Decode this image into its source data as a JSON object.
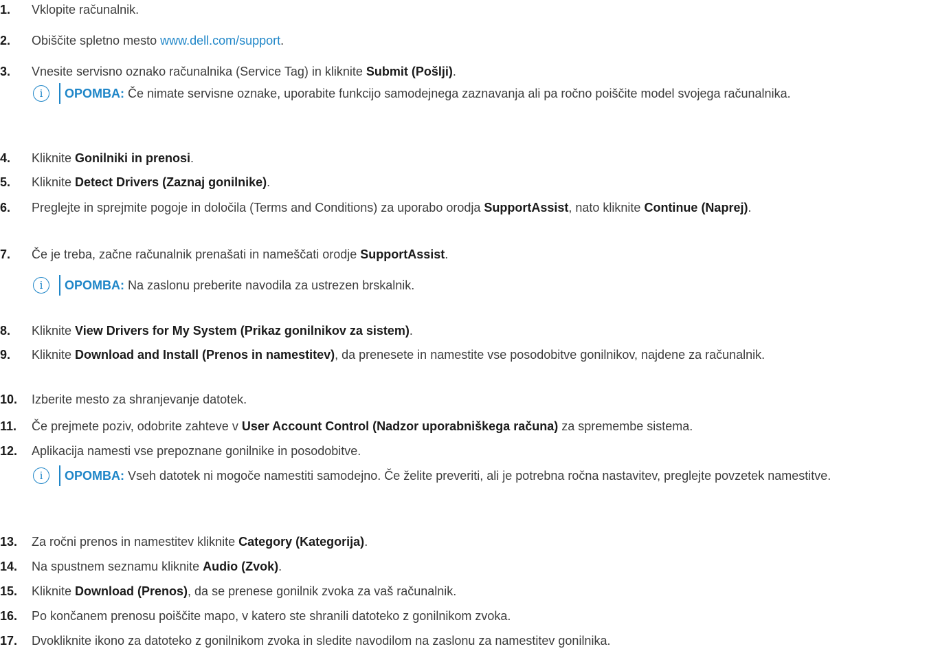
{
  "steps": [
    {
      "num": "1.",
      "parts": [
        {
          "t": "Vklopite računalnik."
        }
      ]
    },
    {
      "num": "2.",
      "parts": [
        {
          "t": "Obiščite spletno mesto "
        },
        {
          "t": "www.dell.com/support",
          "link": true
        },
        {
          "t": "."
        }
      ]
    },
    {
      "num": "3.",
      "parts": [
        {
          "t": "Vnesite servisno oznako računalnika (Service Tag) in kliknite "
        },
        {
          "t": "Submit (Pošlji)",
          "b": true
        },
        {
          "t": "."
        }
      ]
    },
    {
      "num": "4.",
      "parts": [
        {
          "t": "Kliknite "
        },
        {
          "t": "Gonilniki in prenosi",
          "b": true
        },
        {
          "t": "."
        }
      ]
    },
    {
      "num": "5.",
      "parts": [
        {
          "t": "Kliknite "
        },
        {
          "t": "Detect Drivers (Zaznaj gonilnike)",
          "b": true
        },
        {
          "t": "."
        }
      ]
    },
    {
      "num": "6.",
      "parts": [
        {
          "t": "Preglejte in sprejmite pogoje in določila (Terms and Conditions) za uporabo orodja "
        },
        {
          "t": "SupportAssist",
          "b": true
        },
        {
          "t": ", nato kliknite "
        },
        {
          "t": "Continue (Naprej)",
          "b": true
        },
        {
          "t": "."
        }
      ]
    },
    {
      "num": "7.",
      "parts": [
        {
          "t": "Če je treba, začne računalnik prenašati in nameščati orodje "
        },
        {
          "t": "SupportAssist",
          "b": true
        },
        {
          "t": "."
        }
      ]
    },
    {
      "num": "8.",
      "parts": [
        {
          "t": "Kliknite "
        },
        {
          "t": "View Drivers for My System (Prikaz gonilnikov za sistem)",
          "b": true
        },
        {
          "t": "."
        }
      ]
    },
    {
      "num": "9.",
      "parts": [
        {
          "t": "Kliknite "
        },
        {
          "t": "Download and Install (Prenos in namestitev)",
          "b": true
        },
        {
          "t": ", da prenesete in namestite vse posodobitve gonilnikov, najdene za računalnik."
        }
      ]
    },
    {
      "num": "10.",
      "parts": [
        {
          "t": "Izberite mesto za shranjevanje datotek."
        }
      ]
    },
    {
      "num": "11.",
      "parts": [
        {
          "t": "Če prejmete poziv, odobrite zahteve v "
        },
        {
          "t": "User Account Control (Nadzor uporabniškega računa)",
          "b": true
        },
        {
          "t": " za spremembe sistema."
        }
      ]
    },
    {
      "num": "12.",
      "parts": [
        {
          "t": "Aplikacija namesti vse prepoznane gonilnike in posodobitve."
        }
      ]
    },
    {
      "num": "13.",
      "parts": [
        {
          "t": "Za ročni prenos in namestitev kliknite "
        },
        {
          "t": "Category (Kategorija)",
          "b": true
        },
        {
          "t": "."
        }
      ]
    },
    {
      "num": "14.",
      "parts": [
        {
          "t": "Na spustnem seznamu kliknite "
        },
        {
          "t": "Audio (Zvok)",
          "b": true
        },
        {
          "t": "."
        }
      ]
    },
    {
      "num": "15.",
      "parts": [
        {
          "t": "Kliknite "
        },
        {
          "t": "Download (Prenos)",
          "b": true
        },
        {
          "t": ", da se prenese gonilnik zvoka za vaš računalnik."
        }
      ]
    },
    {
      "num": "16.",
      "parts": [
        {
          "t": "Po končanem prenosu poiščite mapo, v katero ste shranili datoteko z gonilnikom zvoka."
        }
      ]
    },
    {
      "num": "17.",
      "parts": [
        {
          "t": "Dvokliknite ikono za datoteko z gonilnikom zvoka in sledite navodilom na zaslonu za namestitev gonilnika."
        }
      ]
    }
  ],
  "notes": {
    "label": "OPOMBA:",
    "icon": "info-icon",
    "accent_color": "#1f86c8",
    "n1": "Če nimate servisne oznake, uporabite funkcijo samodejnega zaznavanja ali pa ročno poiščite model svojega računalnika.",
    "n2": "Na zaslonu preberite navodila za ustrezen brskalnik.",
    "n3": "Vseh datotek ni mogoče namestiti samodejno. Če želite preveriti, ali je potrebna ročna nastavitev, preglejte povzetek namestitve."
  }
}
